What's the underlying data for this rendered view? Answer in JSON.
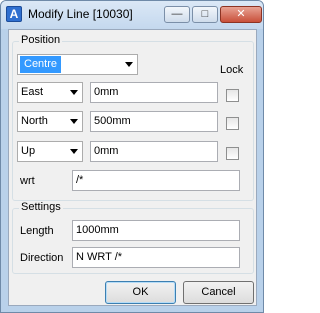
{
  "window": {
    "title": "Modify Line [10030]",
    "app_icon_letter": "A"
  },
  "position": {
    "group_label": "Position",
    "mode_value": "Centre",
    "lock_label": "Lock",
    "rows": [
      {
        "axis": "East",
        "value": "0mm",
        "locked": false
      },
      {
        "axis": "North",
        "value": "500mm",
        "locked": false
      },
      {
        "axis": "Up",
        "value": "0mm",
        "locked": false
      }
    ],
    "wrt_label": "wrt",
    "wrt_value": "/*"
  },
  "settings": {
    "group_label": "Settings",
    "length_label": "Length",
    "length_value": "1000mm",
    "direction_label": "Direction",
    "direction_value": "N WRT /*"
  },
  "buttons": {
    "ok": "OK",
    "cancel": "Cancel"
  }
}
